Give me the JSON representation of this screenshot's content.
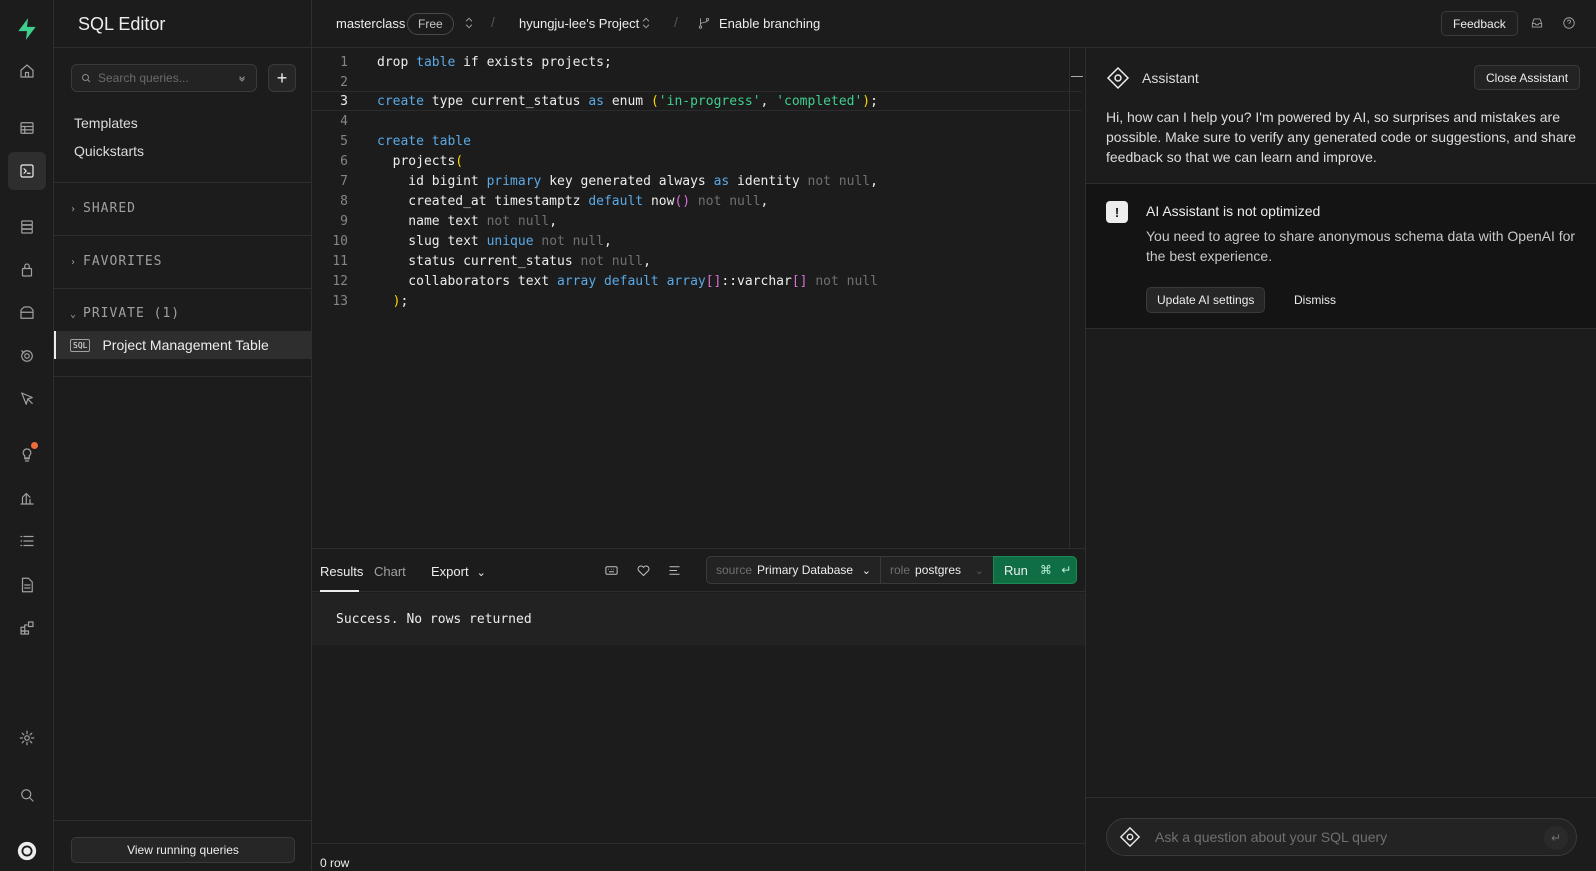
{
  "rail": {
    "items": [
      "logo-icon",
      "home-icon",
      "table-editor-icon",
      "sql-editor-icon",
      "database-icon",
      "auth-icon",
      "storage-icon",
      "realtime-icon",
      "edge-functions-icon",
      "advisors-icon",
      "reports-icon",
      "logs-icon",
      "api-docs-icon",
      "integrations-icon",
      "settings-icon",
      "search-icon",
      "account-icon"
    ],
    "active": "sql-editor-icon"
  },
  "sidebar": {
    "title": "SQL Editor",
    "search_placeholder": "Search queries...",
    "links": [
      "Templates",
      "Quickstarts"
    ],
    "sections": {
      "shared": "SHARED",
      "favorites": "FAVORITES",
      "private": "PRIVATE (1)"
    },
    "query_badge": "SQL",
    "active_query": "Project Management Table",
    "view_running": "View running queries"
  },
  "topbar": {
    "org": "masterclass",
    "plan": "Free",
    "project": "hyungju-lee's Project",
    "branching": "Enable branching",
    "feedback": "Feedback",
    "sep": "/"
  },
  "editor": {
    "current_line": 3,
    "lines": [
      "drop table if exists projects;",
      "",
      "create type current_status as enum ('in-progress', 'completed');",
      "",
      "create table",
      "  projects(",
      "    id bigint primary key generated always as identity not null,",
      "    created_at timestamptz default now() not null,",
      "    name text not null,",
      "    slug text unique not null,",
      "    status current_status not null,",
      "    collaborators text array default array[]::varchar[] not null",
      "  );"
    ]
  },
  "results": {
    "tabs": [
      "Results",
      "Chart"
    ],
    "export": "Export",
    "source_label": "source",
    "source_value": "Primary Database",
    "role_label": "role",
    "role_value": "postgres",
    "run": "Run",
    "run_shortcut": "⌘ ↵",
    "message": "Success. No rows returned",
    "row_count": "0 row"
  },
  "assistant": {
    "title": "Assistant",
    "close": "Close Assistant",
    "intro": "Hi, how can I help you? I'm powered by AI, so surprises and mistakes are possible. Make sure to verify any generated code or suggestions, and share feedback so that we can learn and improve.",
    "warning_title": "AI Assistant is not optimized",
    "warning_body": "You need to agree to share anonymous schema data with OpenAI for the best experience.",
    "update_button": "Update AI settings",
    "dismiss": "Dismiss",
    "input_placeholder": "Ask a question about your SQL query"
  }
}
